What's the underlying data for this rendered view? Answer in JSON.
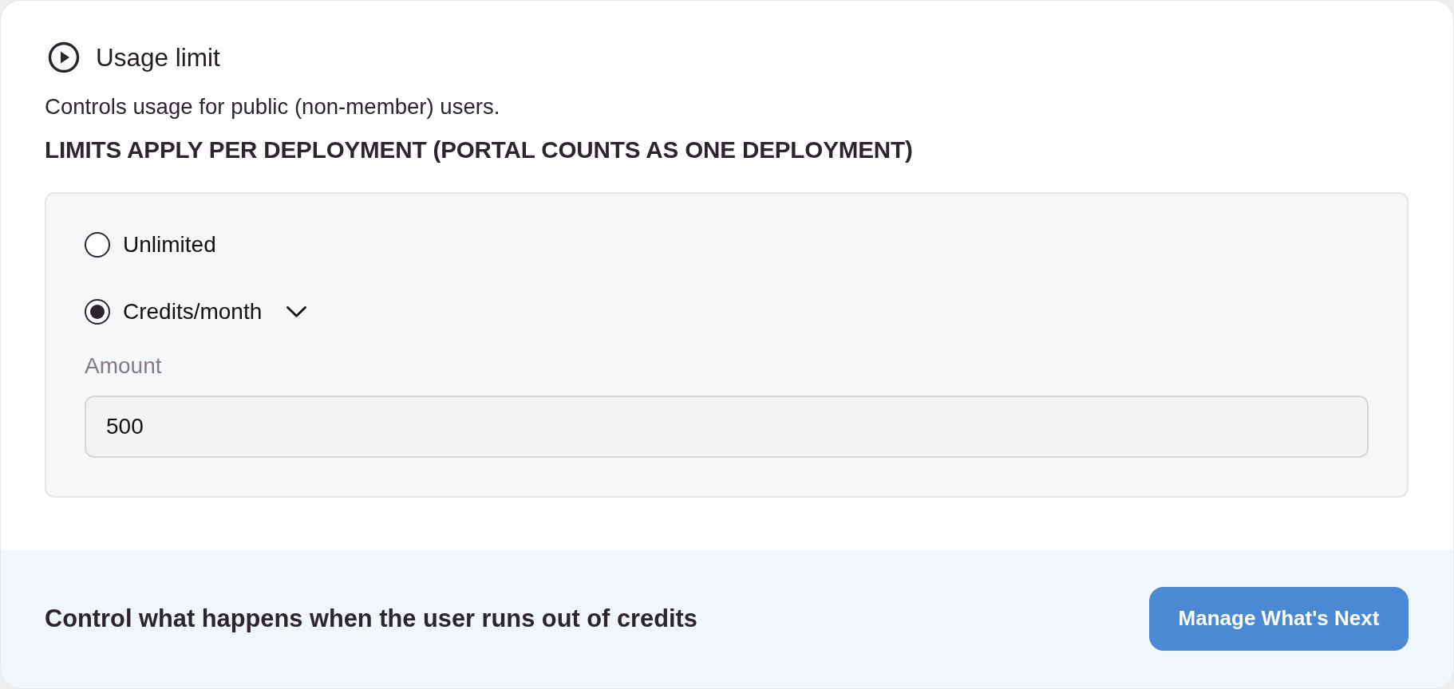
{
  "section": {
    "title": "Usage limit",
    "description": "Controls usage for public (non-member) users.",
    "note": "LIMITS APPLY PER DEPLOYMENT (PORTAL COUNTS AS ONE DEPLOYMENT)"
  },
  "options": [
    {
      "label": "Unlimited",
      "selected": false,
      "has_dropdown": false
    },
    {
      "label": "Credits/month",
      "selected": true,
      "has_dropdown": true
    }
  ],
  "amount_field": {
    "label": "Amount",
    "value": "500"
  },
  "footer": {
    "text": "Control what happens when the user runs out of credits",
    "button": "Manage What's Next"
  }
}
